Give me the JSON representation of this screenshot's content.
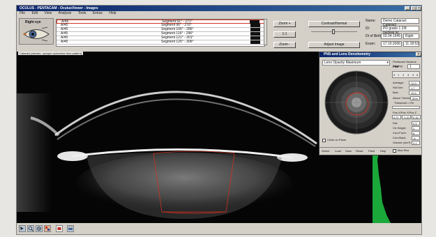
{
  "app": {
    "title": "OCULUS - PENTACAM - OculusViewer - Images",
    "menu": [
      "File",
      "Edit",
      "View",
      "Analysis",
      "Tools",
      "Extras",
      "Help"
    ]
  },
  "eye": {
    "label": "Right eye"
  },
  "segments": [
    {
      "axis": "A/45",
      "label": "Segment 91° - 271°"
    },
    {
      "axis": "A/45",
      "label": "Segment 96° - 276°"
    },
    {
      "axis": "A/45",
      "label": "Segment 106° - 286°"
    },
    {
      "axis": "A/45",
      "label": "Segment 116° - 296°"
    },
    {
      "axis": "A/45",
      "label": "Segment 121° - 301°"
    },
    {
      "axis": "A/45",
      "label": "Segment 126° - 306°"
    }
  ],
  "zoom": {
    "in_label": "Zoom +",
    "reset_label": "1:1",
    "out_label": "Zoom -"
  },
  "contrast": {
    "button_label": "Contrast/Normal",
    "adjust_label": "Adjust Image"
  },
  "patient": {
    "name_label": "Name:",
    "name_value": "Demo Cataract Cataract",
    "id_label": "ID:",
    "id_value": "PD grade 1 2/8 nuclear sc",
    "dob_label": "Dt of Birth:",
    "dob_value": "03.04.1945",
    "eye_value": "Right",
    "exam_label": "Exam:",
    "exam_date": "17.10.2006",
    "exam_time": "11:18:53"
  },
  "image": {
    "caption": "Cataract (densito- opaque epinuclear lens pattern)"
  },
  "pnt": {
    "title": "PNS and Lens Densitometry",
    "mode": "Lens Opacity Maximum",
    "pnt_label": "Pentacam Nucleus Staging",
    "pnt_sub": "PNS",
    "pnt_value": "1",
    "grades": [
      "0",
      "1",
      "2",
      "3",
      "4",
      "5"
    ],
    "stats": [
      {
        "label": "Average:",
        "value": "12.0"
      },
      {
        "label": "Std Dev:",
        "value": "1.7"
      },
      {
        "label": "Max:",
        "value": "19.4"
      }
    ],
    "above_label": "Above Thresh.:",
    "above_value": "50%",
    "threshold_label": "Threshold = 0%",
    "pos_label": "Pos X/Pos Y/Pos Z",
    "pos_values": [
      "0.07",
      "-0.31",
      "0.32"
    ],
    "fields": [
      {
        "label": "Dia:",
        "value": "0.5"
      },
      {
        "label": "Ctr Height:",
        "value": "2"
      },
      {
        "label": "Curv.Front:",
        "value": "8"
      },
      {
        "label": "Curv.Back:",
        "value": "-6"
      },
      {
        "label": "Volume (mm³):",
        "value": "3.1"
      }
    ],
    "circle_label": "Circle on Plane",
    "bottom": [
      "Select",
      "Load",
      "Save",
      "Reset",
      "Paint",
      "Help"
    ],
    "max_label": "Max Rea"
  },
  "colors": {
    "titlebar": "#0a246a",
    "panel": "#d4d0c8",
    "image_bg": "#050505",
    "overlay_red": "#d03020",
    "graph_green": "#1aa83a"
  },
  "icons": [
    "eye-icon",
    "arrow-icon",
    "zoom-icon",
    "settings-icon",
    "color-icon",
    "export-icon",
    "print-icon"
  ]
}
